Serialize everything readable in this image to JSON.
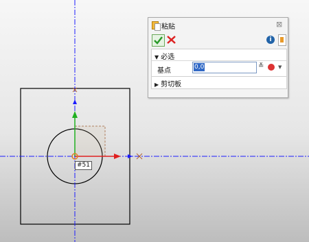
{
  "panel": {
    "title": "粘贴",
    "close_label": "⊠",
    "info_label": "i",
    "required_section": "必选",
    "base_point_label": "基点",
    "base_point_value": "0,0",
    "clipboard_section": "剪切板",
    "expand_glyph": "▼",
    "collapse_glyph": "▶",
    "dropdown_glyph": "≚",
    "snap_arrow": "▼"
  },
  "canvas": {
    "point_label": "#51",
    "background_top": "#f7f7f7",
    "background_bottom": "#bdbdbd",
    "axis_color": "#1a1aff",
    "x_axis_color": "#e02020",
    "y_axis_color": "#20b020"
  }
}
